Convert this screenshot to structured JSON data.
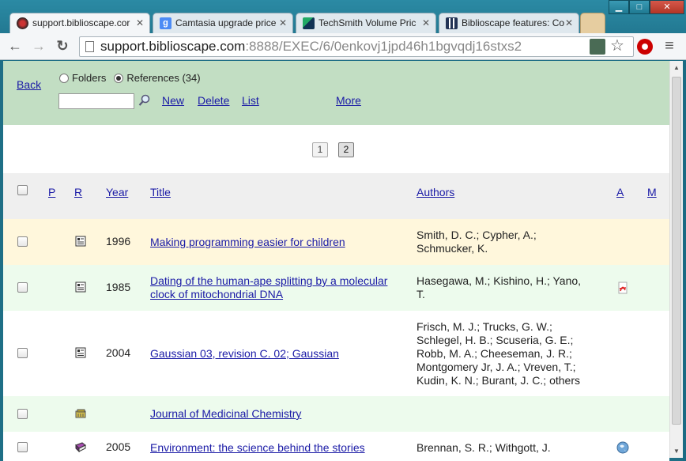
{
  "browser": {
    "tabs": [
      {
        "label": "support.biblioscape.cor",
        "active": true
      },
      {
        "label": "Camtasia upgrade price",
        "active": false
      },
      {
        "label": "TechSmith Volume Pric",
        "active": false
      },
      {
        "label": "Biblioscape features: Co",
        "active": false
      }
    ],
    "tab_close": "✕",
    "url_host": "support.biblioscape.com",
    "url_rest": ":8888/EXEC/6/0enkovj1jpd46h1bgvqdj16stxs2",
    "window_controls": {
      "minimize": "▁",
      "maximize": "□",
      "close": "✕"
    },
    "nav": {
      "back": "←",
      "forward": "→",
      "reload": "↻",
      "star": "☆",
      "menu": "≡"
    }
  },
  "toolbar": {
    "back_label": "Back",
    "radio_folders": "Folders",
    "radio_references": "References (34)",
    "search_value": "",
    "new_label": "New",
    "delete_label": "Delete",
    "list_label": "List",
    "more_label": "More"
  },
  "pagination": {
    "pages": [
      "1",
      "2"
    ],
    "current": "2"
  },
  "table": {
    "headers": {
      "p": "P",
      "r": "R",
      "year": "Year",
      "title": "Title",
      "authors": "Authors",
      "a": "A",
      "m": "M"
    },
    "rows": [
      {
        "year": "1996",
        "title_lines": [
          "Making programming easier for children"
        ],
        "author_lines": [
          "Smith, D. C.; Cypher, A.;",
          "Schmucker, K."
        ],
        "ref_icon": "document-icon",
        "attach_icon": ""
      },
      {
        "year": "1985",
        "title_lines": [
          "Dating of the human-ape splitting by a molecular",
          "clock of mitochondrial DNA"
        ],
        "author_lines": [
          "Hasegawa, M.; Kishino, H.; Yano,",
          "T."
        ],
        "ref_icon": "document-icon",
        "attach_icon": "pdf-icon"
      },
      {
        "year": "2004",
        "title_lines": [
          "Gaussian 03, revision C. 02; Gaussian"
        ],
        "author_lines": [
          "Frisch, M. J.; Trucks, G. W.;",
          "Schlegel, H. B.; Scuseria, G. E.;",
          "Robb, M. A.; Cheeseman, J. R.;",
          "Montgomery Jr, J. A.; Vreven, T.;",
          "Kudin, K. N.; Burant, J. C.; others"
        ],
        "ref_icon": "document-icon",
        "attach_icon": ""
      },
      {
        "year": "",
        "title_lines": [
          "Journal of Medicinal Chemistry"
        ],
        "author_lines": [],
        "ref_icon": "journal-icon",
        "attach_icon": ""
      },
      {
        "year": "2005",
        "title_lines": [
          "Environment: the science behind the stories"
        ],
        "author_lines": [
          "Brennan, S. R.; Withgott, J."
        ],
        "ref_icon": "book-icon",
        "attach_icon": "globe-icon"
      }
    ]
  },
  "colors": {
    "toolbar_bg": "#c2dec3",
    "row_yellow": "#fff7dc",
    "row_green": "#edfbed",
    "link": "#1a1aa6"
  }
}
